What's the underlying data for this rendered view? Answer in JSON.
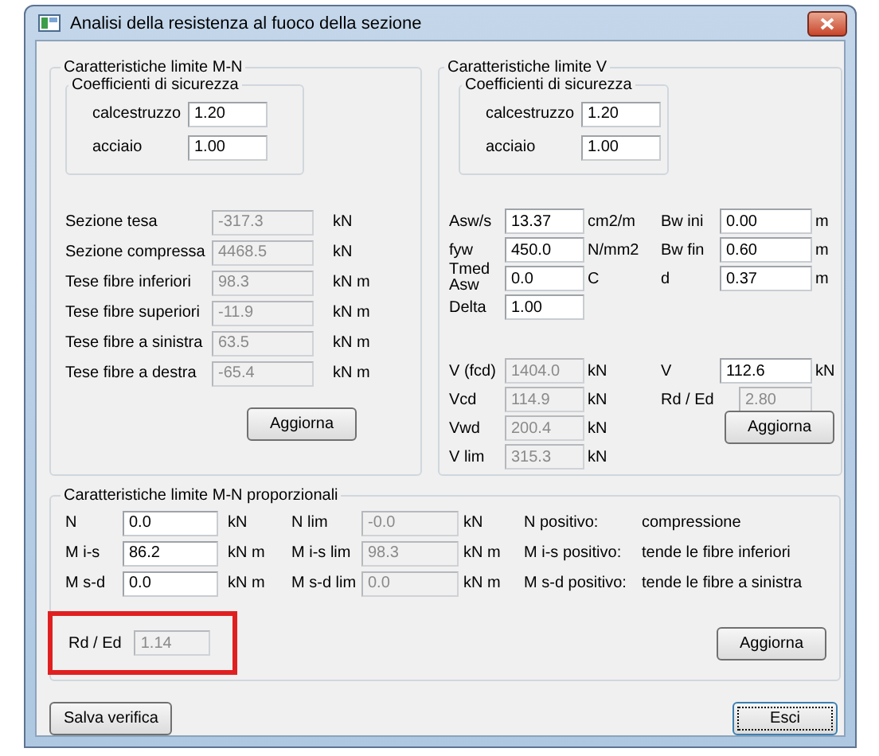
{
  "window": {
    "title": "Analisi della resistenza al fuoco della sezione"
  },
  "mn_group": {
    "title": "Caratteristiche limite M-N",
    "coefficients": {
      "title": "Coefficienti di sicurezza",
      "rows": [
        {
          "label": "calcestruzzo",
          "value": "1.20",
          "disabled": false
        },
        {
          "label": "acciaio",
          "value": "1.00",
          "disabled": false
        }
      ]
    },
    "rows": [
      {
        "label": "Sezione tesa",
        "value": "-317.3",
        "unit": "kN",
        "disabled": true
      },
      {
        "label": "Sezione compressa",
        "value": "4468.5",
        "unit": "kN",
        "disabled": true
      },
      {
        "label": "Tese fibre inferiori",
        "value": "98.3",
        "unit": "kN m",
        "disabled": true
      },
      {
        "label": "Tese fibre superiori",
        "value": "-11.9",
        "unit": "kN m",
        "disabled": true
      },
      {
        "label": "Tese fibre a sinistra",
        "value": "63.5",
        "unit": "kN m",
        "disabled": true
      },
      {
        "label": "Tese fibre a destra",
        "value": "-65.4",
        "unit": "kN m",
        "disabled": true
      }
    ],
    "button": "Aggiorna"
  },
  "v_group": {
    "title": "Caratteristiche limite V",
    "coefficients": {
      "title": "Coefficienti di sicurezza",
      "rows": [
        {
          "label": "calcestruzzo",
          "value": "1.20",
          "disabled": false
        },
        {
          "label": "acciaio",
          "value": "1.00",
          "disabled": false
        }
      ]
    },
    "inputs": [
      {
        "label": "Asw/s",
        "value": "13.37",
        "unit": "cm2/m",
        "disabled": false
      },
      {
        "label": "fyw",
        "value": "450.0",
        "unit": "N/mm2",
        "disabled": false
      },
      {
        "label": "Tmed Asw",
        "value": "0.0",
        "unit": "C",
        "disabled": false
      },
      {
        "label": "Delta",
        "value": "1.00",
        "disabled": false
      }
    ],
    "geometry": [
      {
        "label": "Bw ini",
        "value": "0.00",
        "unit": "m",
        "disabled": false
      },
      {
        "label": "Bw fin",
        "value": "0.60",
        "unit": "m",
        "disabled": false
      },
      {
        "label": "d",
        "value": "0.37",
        "unit": "m",
        "disabled": false
      }
    ],
    "results": [
      {
        "label": "V (fcd)",
        "value": "1404.0",
        "unit": "kN",
        "disabled": true
      },
      {
        "label": "Vcd",
        "value": "114.9",
        "unit": "kN",
        "disabled": true
      },
      {
        "label": "Vwd",
        "value": "200.4",
        "unit": "kN",
        "disabled": true
      },
      {
        "label": "V lim",
        "value": "315.3",
        "unit": "kN",
        "disabled": true
      }
    ],
    "checks": [
      {
        "label": "V",
        "value": "112.6",
        "unit": "kN",
        "disabled": false
      },
      {
        "label": "Rd / Ed",
        "value": "2.80",
        "disabled": true
      }
    ],
    "button": "Aggiorna"
  },
  "proportional": {
    "title": "Caratteristiche limite M-N proporzionali",
    "rows": [
      {
        "label": "N",
        "input": {
          "value": "0.0",
          "disabled": false
        },
        "unit": "kN",
        "limit_label": "N lim",
        "limit": {
          "value": "-0.0",
          "disabled": true
        },
        "limit_unit": "kN",
        "note_label": "N positivo:",
        "note_text": "compressione"
      },
      {
        "label": "M i-s",
        "input": {
          "value": "86.2",
          "disabled": false
        },
        "unit": "kN m",
        "limit_label": "M i-s lim",
        "limit": {
          "value": "98.3",
          "disabled": true
        },
        "limit_unit": "kN m",
        "note_label": "M i-s  positivo:",
        "note_text": "tende le fibre inferiori"
      },
      {
        "label": "M s-d",
        "input": {
          "value": "0.0",
          "disabled": false
        },
        "unit": "kN m",
        "limit_label": "M s-d lim",
        "limit": {
          "value": "0.0",
          "disabled": true
        },
        "limit_unit": "kN m",
        "note_label": "M s-d positivo:",
        "note_text": "tende le fibre a sinistra"
      }
    ],
    "ratio": {
      "label": "Rd / Ed",
      "value": "1.14",
      "disabled": true,
      "highlighted": true
    },
    "button": "Aggiorna"
  },
  "buttons": [
    {
      "label": "Salva verifica",
      "default": false
    },
    {
      "label": "Esci",
      "default": true
    }
  ]
}
